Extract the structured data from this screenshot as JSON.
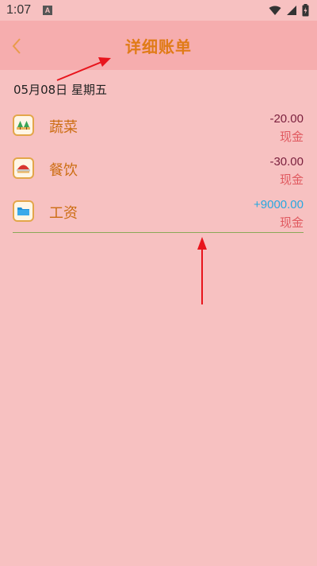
{
  "status": {
    "time": "1:07",
    "notif_letter": "A"
  },
  "header": {
    "title": "详细账单"
  },
  "date": "05月08日 星期五",
  "records": [
    {
      "icon": "trees-icon",
      "name": "蔬菜",
      "amount": "-20.00",
      "method": "现金",
      "amount_color": "#7a1f3d"
    },
    {
      "icon": "bowl-icon",
      "name": "餐饮",
      "amount": "-30.00",
      "method": "现金",
      "amount_color": "#7a1f3d"
    },
    {
      "icon": "folder-icon",
      "name": "工资",
      "amount": "+9000.00",
      "method": "现金",
      "amount_color": "#28a8e0"
    }
  ],
  "colors": {
    "background": "#f7c1c1",
    "header": "#f6adae",
    "accent": "#e07b17",
    "annotation": "#e8141c"
  }
}
